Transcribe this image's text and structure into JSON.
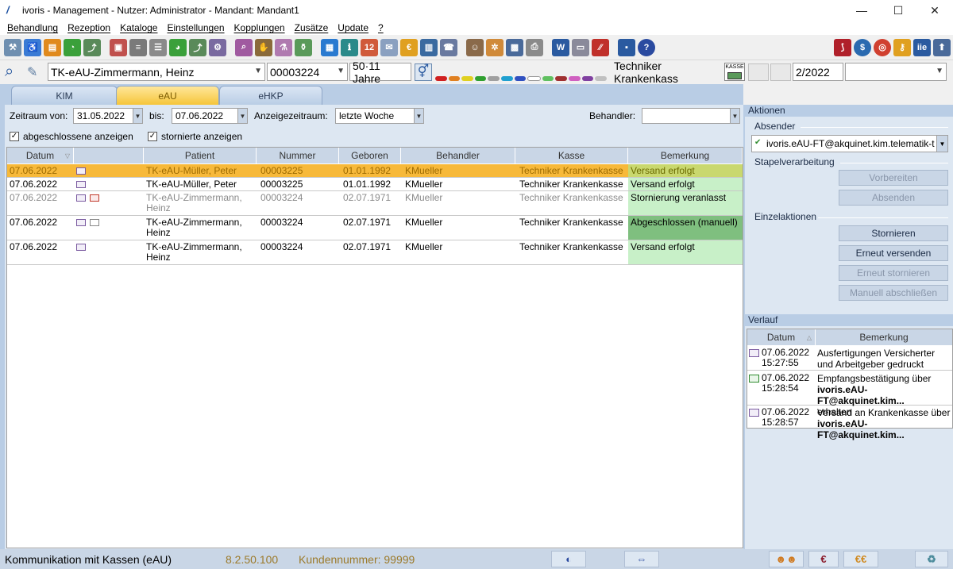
{
  "window": {
    "title": "ivoris - Management - Nutzer: Administrator - Mandant: Mandant1",
    "minimize": "—",
    "maximize": "☐",
    "close": "✕"
  },
  "menu": [
    "Behandlung",
    "Rezeption",
    "Kataloge",
    "Einstellungen",
    "Kopplungen",
    "Zusätze",
    "Update",
    "?"
  ],
  "patient": {
    "name": "TK-eAU-Zimmermann, Heinz",
    "number": "00003224",
    "age": "50·11 Jahre",
    "insurance": "Techniker Krankenkass",
    "kasse_label": "KASSE",
    "quarter": "2/2022"
  },
  "tabs": [
    "KIM",
    "eAU",
    "eHKP"
  ],
  "filter": {
    "zeitraum_label": "Zeitraum von:",
    "from": "31.05.2022",
    "bis_label": "bis:",
    "to": "07.06.2022",
    "anzeige_label": "Anzeigezeitraum:",
    "anzeige_value": "letzte Woche",
    "behandler_label": "Behandler:",
    "behandler_value": "",
    "show_closed": "abgeschlossene anzeigen",
    "show_cancelled": "stornierte anzeigen"
  },
  "grid": {
    "columns": [
      "Datum",
      "Patient",
      "Nummer",
      "Geboren",
      "Behandler",
      "Kasse",
      "Bemerkung"
    ],
    "rows": [
      {
        "date": "07.06.2022",
        "patient": "TK-eAU-Müller, Peter",
        "number": "00003225",
        "born": "01.01.1992",
        "doctor": "KMueller",
        "kasse": "Techniker Krankenkasse",
        "remark": "Versand erfolgt"
      },
      {
        "date": "07.06.2022",
        "patient": "TK-eAU-Müller, Peter",
        "number": "00003225",
        "born": "01.01.1992",
        "doctor": "KMueller",
        "kasse": "Techniker Krankenkasse",
        "remark": "Versand erfolgt"
      },
      {
        "date": "07.06.2022",
        "patient": "TK-eAU-Zimmermann, Heinz",
        "number": "00003224",
        "born": "02.07.1971",
        "doctor": "KMueller",
        "kasse": "Techniker Krankenkasse",
        "remark": "Stornierung veranlasst"
      },
      {
        "date": "07.06.2022",
        "patient": "TK-eAU-Zimmermann, Heinz",
        "number": "00003224",
        "born": "02.07.1971",
        "doctor": "KMueller",
        "kasse": "Techniker Krankenkasse",
        "remark": "Abgeschlossen (manuell)"
      },
      {
        "date": "07.06.2022",
        "patient": "TK-eAU-Zimmermann, Heinz",
        "number": "00003224",
        "born": "02.07.1971",
        "doctor": "KMueller",
        "kasse": "Techniker Krankenkasse",
        "remark": "Versand erfolgt"
      }
    ]
  },
  "actions": {
    "header": "Aktionen",
    "absender_label": "Absender",
    "absender_value": "ivoris.eAU-FT@akquinet.kim.telematik-t",
    "stapel_label": "Stapelverarbeitung",
    "vorbereiten": "Vorbereiten",
    "absenden": "Absenden",
    "einzel_label": "Einzelaktionen",
    "stornieren": "Stornieren",
    "erneut_versenden": "Erneut versenden",
    "erneut_stornieren": "Erneut stornieren",
    "manuell_abschliessen": "Manuell abschließen"
  },
  "history": {
    "header": "Verlauf",
    "columns": [
      "Datum",
      "Bemerkung"
    ],
    "rows": [
      {
        "date": "07.06.2022",
        "time": "15:27:55",
        "text": "Ausfertigungen Versicherter und Arbeitgeber gedruckt",
        "bold": "",
        "tail": ""
      },
      {
        "date": "07.06.2022",
        "time": "15:28:54",
        "text": "Empfangsbestätigung über",
        "bold": "ivoris.eAU-FT@akquinet.kim...",
        "tail": "erhalten"
      },
      {
        "date": "07.06.2022",
        "time": "15:28:57",
        "text": "Versand an Krankenkasse über",
        "bold": "ivoris.eAU-FT@akquinet.kim...",
        "tail": ""
      }
    ]
  },
  "status": {
    "module": "Kommunikation mit Kassen (eAU)",
    "version": "8.2.50.100",
    "customer": "Kundennummer: 99999"
  },
  "colors": {
    "selected_row": "#f7b93a",
    "remark_green": "#c8f0c8",
    "remark_dark": "#7fbf7f",
    "panel": "#dde7f2",
    "header": "#b9cde5"
  }
}
